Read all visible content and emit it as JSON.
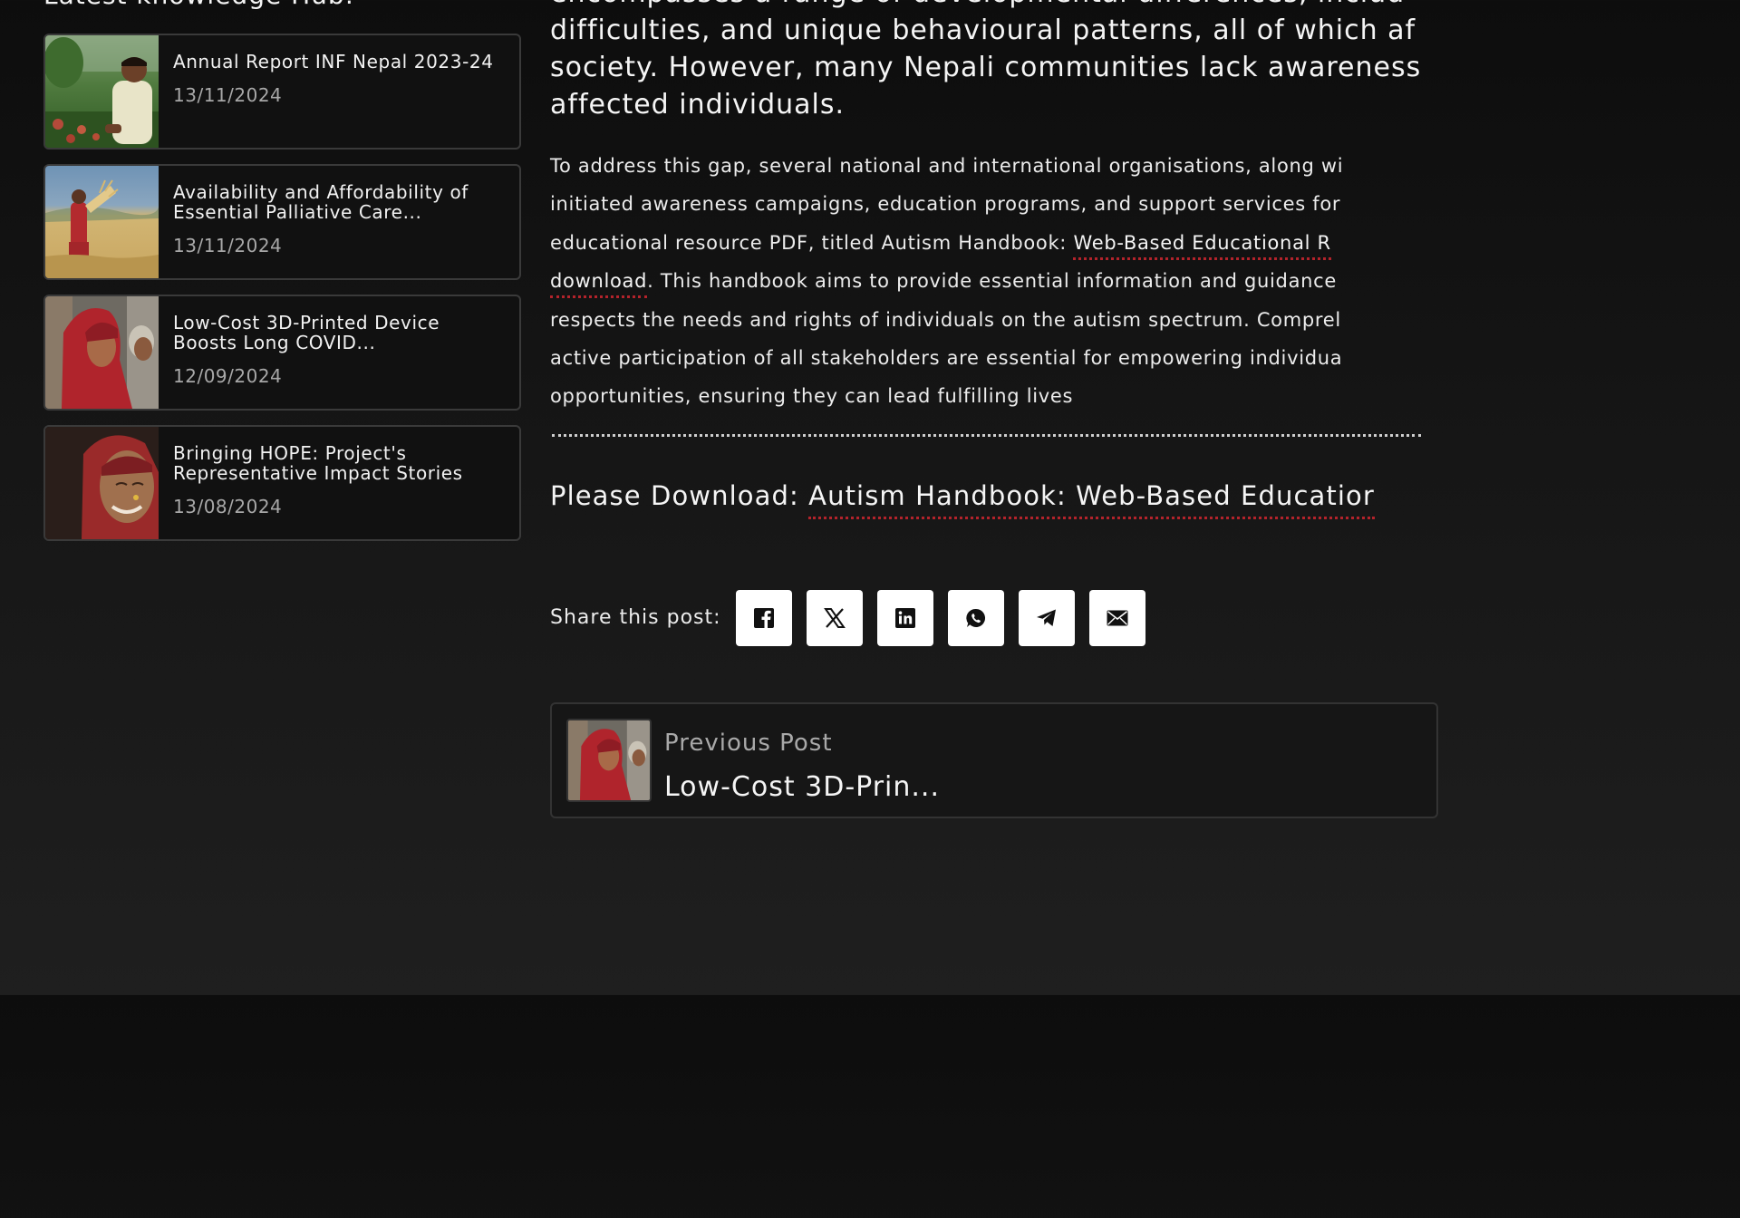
{
  "sidebar": {
    "heading": "Latest knowledge Hub:",
    "items": [
      {
        "title": "Annual Report INF Nepal 2023-24",
        "date": "13/11/2024",
        "thumb": "farmer-photo"
      },
      {
        "title": "Availability and Affordability of Essential Palliative Care...",
        "date": "13/11/2024",
        "thumb": "wheat-field-photo"
      },
      {
        "title": "Low-Cost 3D-Printed Device Boosts Long COVID...",
        "date": "12/09/2024",
        "thumb": "woman-red-shawl-photo"
      },
      {
        "title": "Bringing HOPE: Project's Representative Impact Stories",
        "date": "13/08/2024",
        "thumb": "elderly-woman-smiling-photo"
      }
    ]
  },
  "article": {
    "lead_lines": [
      "encompasses a range of developmental differences, includ",
      "difficulties, and unique behavioural patterns, all of which af",
      "society. However, many Nepali communities lack awareness",
      "affected individuals."
    ],
    "body": {
      "line1": "To address this gap, several national and international organisations, along wi",
      "line2": "initiated awareness campaigns, education programs, and support services for",
      "line3_pre": "educational resource PDF, titled Autism Handbook: ",
      "line3_link": "Web-Based Educational R",
      "line4_link": "download",
      "line4_post": ". This handbook aims to provide essential information and guidance",
      "line5": "respects the needs and rights of individuals on the autism spectrum. Comprel",
      "line6": "active participation of all stakeholders are essential for empowering individua",
      "line7": "opportunities, ensuring they can lead fulfilling lives"
    },
    "download_prefix": "Please Download: ",
    "download_link": "Autism Handbook: Web-Based Educatior"
  },
  "share": {
    "label": "Share this post:",
    "buttons": [
      "facebook-icon",
      "x-icon",
      "linkedin-icon",
      "whatsapp-icon",
      "telegram-icon",
      "email-icon"
    ]
  },
  "previous_post": {
    "label": "Previous Post",
    "title": "Low-Cost 3D-Prin..."
  },
  "colors": {
    "background": "#121212",
    "link_underline": "#b3232b",
    "card_border": "#3a3a3a",
    "muted_text": "#a8a8a8"
  }
}
